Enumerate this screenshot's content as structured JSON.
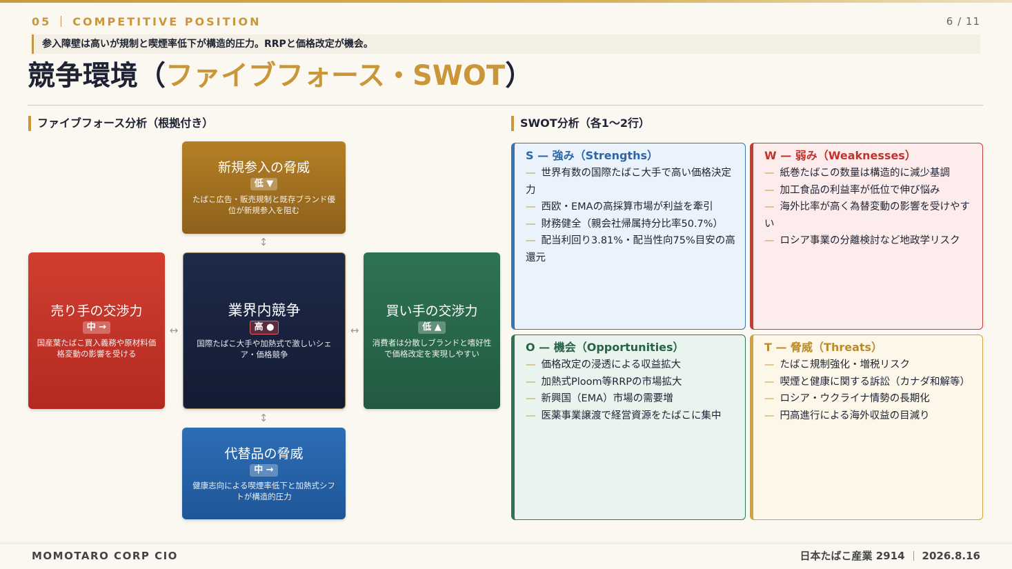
{
  "header": {
    "section_number": "05",
    "section_label": "COMPETITIVE POSITION",
    "page": "6 / 11"
  },
  "lead_text": "参入障壁は高いが規制と喫煙率低下が構造的圧力。RRPと価格改定が機会。",
  "title": {
    "main": "競争環境（",
    "accent": "ファイブフォース・SWOT",
    "close": "）"
  },
  "five_forces": {
    "heading": "ファイブフォース分析（根拠付き）",
    "new_entrants": {
      "name": "新規参入の脅威",
      "level": "低 ▼",
      "desc": "たばこ広告・販売規制と既存ブランド優位が新規参入を阻む"
    },
    "suppliers": {
      "name": "売り手の交渉力",
      "level": "中 →",
      "desc": "国産葉たばこ買入義務や原材料価格変動の影響を受ける"
    },
    "rivalry": {
      "name": "業界内競争",
      "level": "高 ●",
      "desc": "国際たばこ大手や加熱式で激しいシェア・価格競争"
    },
    "buyers": {
      "name": "買い手の交渉力",
      "level": "低 ▲",
      "desc": "消費者は分散しブランドと嗜好性で価格改定を実現しやすい"
    },
    "substitutes": {
      "name": "代替品の脅威",
      "level": "中 →",
      "desc": "健康志向による喫煙率低下と加熱式シフトが構造的圧力"
    },
    "arrows": {
      "vertical": "↕",
      "horizontal": "↔"
    }
  },
  "swot": {
    "heading": "SWOT分析（各1〜2行）",
    "dash": "—",
    "strengths": {
      "title": "S — 強み（Strengths）",
      "items": [
        "世界有数の国際たばこ大手で高い価格決定力",
        "西欧・EMAの高採算市場が利益を牽引",
        "財務健全（親会社帰属持分比率50.7%）",
        "配当利回り3.81%・配当性向75%目安の高還元"
      ]
    },
    "weaknesses": {
      "title": "W — 弱み（Weaknesses）",
      "items": [
        "紙巻たばこの数量は構造的に減少基調",
        "加工食品の利益率が低位で伸び悩み",
        "海外比率が高く為替変動の影響を受けやすい",
        "ロシア事業の分離検討など地政学リスク"
      ]
    },
    "opportunities": {
      "title": "O — 機会（Opportunities）",
      "items": [
        "価格改定の浸透による収益拡大",
        "加熱式Ploom等RRPの市場拡大",
        "新興国（EMA）市場の需要増",
        "医薬事業譲渡で経営資源をたばこに集中"
      ]
    },
    "threats": {
      "title": "T — 脅威（Threats）",
      "items": [
        "たばこ規制強化・増税リスク",
        "喫煙と健康に関する訴訟（カナダ和解等）",
        "ロシア・ウクライナ情勢の長期化",
        "円高進行による海外収益の目減り"
      ]
    }
  },
  "footer": {
    "left": "MOMOTARO CORP CIO",
    "company": "日本たばこ産業 2914",
    "date": "2026.8.16"
  },
  "colors": {
    "accent": "#c9963a",
    "navy": "#1e2233",
    "strength": "#2c66a8",
    "weakness": "#c0322b",
    "opportunity": "#266247",
    "threat": "#b98c2a"
  }
}
